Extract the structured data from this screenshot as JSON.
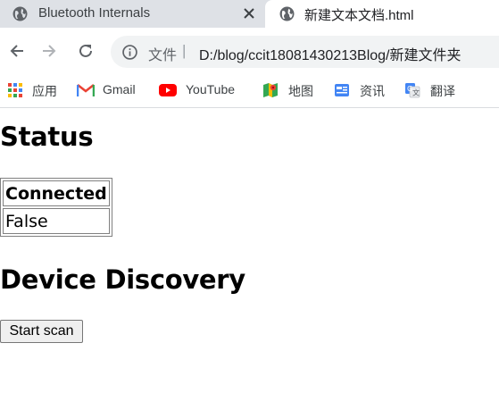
{
  "browser": {
    "tabs": [
      {
        "title": "Bluetooth Internals",
        "active": false
      },
      {
        "title": "新建文本文档.html",
        "active": true
      }
    ],
    "address_bar": {
      "scheme_label": "文件",
      "separator": "|",
      "url": "D:/blog/ccit18081430213Blog/新建文件夹"
    },
    "bookmarks": [
      {
        "label": "应用",
        "icon": "apps-grid-icon"
      },
      {
        "label": "Gmail",
        "icon": "gmail-icon"
      },
      {
        "label": "YouTube",
        "icon": "youtube-icon"
      },
      {
        "label": "地图",
        "icon": "maps-icon"
      },
      {
        "label": "资讯",
        "icon": "news-icon"
      },
      {
        "label": "翻译",
        "icon": "translate-icon"
      }
    ]
  },
  "page": {
    "status_heading": "Status",
    "status_table": {
      "header": "Connected",
      "value": "False"
    },
    "discovery_heading": "Device Discovery",
    "scan_button_label": "Start scan"
  },
  "colors": {
    "tabbar_bg": "#dee1e6",
    "omnibox_bg": "#f1f3f4",
    "youtube_red": "#ff0000",
    "gmail_red": "#ea4335"
  }
}
